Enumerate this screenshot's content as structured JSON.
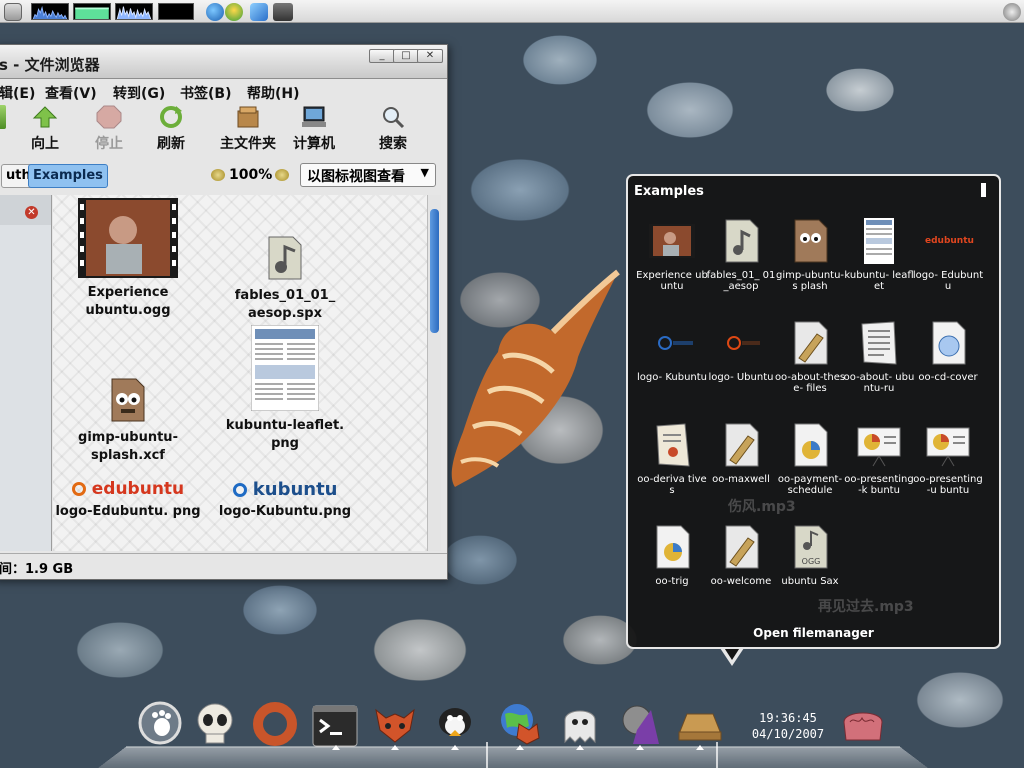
{
  "top_panel": {
    "icons": [
      "computer-icon",
      "cpu-graph",
      "memory-graph",
      "network-graph",
      "load-graph",
      "browser-icon",
      "chat-icon",
      "thunderbird-icon",
      "printer-icon",
      "update-icon"
    ]
  },
  "file_manager": {
    "title": "s - 文件浏览器",
    "menu": [
      "辑(E)",
      "查看(V)",
      "转到(G)",
      "书签(B)",
      "帮助(H)"
    ],
    "toolbar": {
      "up": "向上",
      "stop": "停止",
      "reload": "刷新",
      "home": "主文件夹",
      "computer": "计算机",
      "search": "搜索"
    },
    "breadcrumb": [
      "uth",
      "Examples"
    ],
    "zoom": "100%",
    "view_mode": "以图标视图查看",
    "files": [
      {
        "name": "Experience ubuntu.ogg"
      },
      {
        "name": "fables_01_01_ aesop.spx"
      },
      {
        "name": "gimp-ubuntu- splash.xcf"
      },
      {
        "name": "kubuntu-leaflet. png"
      },
      {
        "name": "logo-Edubuntu. png"
      },
      {
        "name": "logo-Kubuntu.png"
      }
    ],
    "logos": {
      "edubuntu": "edubuntu",
      "kubuntu": "kubuntu"
    },
    "status": "间：1.9 GB"
  },
  "stack": {
    "title": "Examples",
    "items": [
      "Experience ubuntu",
      "fables_01_ 01_aesop",
      "gimp-ubuntu-s plash",
      "kubuntu- leaflet",
      "logo- Edubuntu",
      "logo- Kubuntu",
      "logo- Ubuntu",
      "oo-about-these- files",
      "oo-about- ubuntu-ru",
      "oo-cd-cover",
      "oo-deriva tives",
      "oo-maxwell",
      "oo-payment- schedule",
      "oo-presenting-k buntu",
      "oo-presenting-u buntu",
      "oo-trig",
      "oo-welcome",
      "ubuntu Sax"
    ],
    "edubuntu_logo": "edubuntu",
    "ogg_label": "OGG",
    "open_label": "Open filemanager",
    "ghost_labels": [
      "伤风.mp3",
      "再见过去.mp3"
    ]
  },
  "dock": {
    "icons": [
      "gnome-foot-icon",
      "skull-icon",
      "ring-icon",
      "terminal-icon",
      "firefox-fox-icon",
      "penguin-icon",
      "browser-globe-icon",
      "ghost-icon",
      "wizard-icon",
      "folder-drawer-icon",
      "trash-brain-icon"
    ],
    "clock_time": "19:36:45",
    "clock_date": "04/10/2007"
  }
}
